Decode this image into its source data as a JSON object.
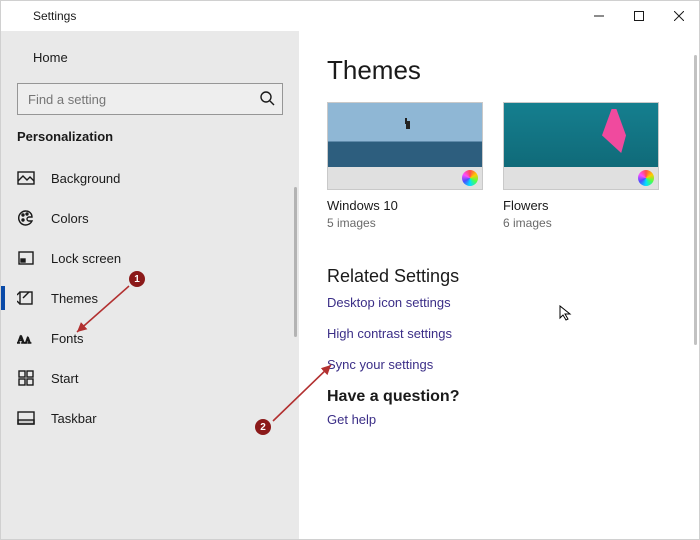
{
  "titlebar": {
    "title": "Settings"
  },
  "sidebar": {
    "home_label": "Home",
    "search_placeholder": "Find a setting",
    "section_label": "Personalization",
    "items": [
      {
        "label": "Background"
      },
      {
        "label": "Colors"
      },
      {
        "label": "Lock screen"
      },
      {
        "label": "Themes"
      },
      {
        "label": "Fonts"
      },
      {
        "label": "Start"
      },
      {
        "label": "Taskbar"
      }
    ]
  },
  "main": {
    "heading": "Themes",
    "themes": [
      {
        "name": "Windows 10",
        "sub": "5 images"
      },
      {
        "name": "Flowers",
        "sub": "6 images"
      }
    ],
    "related_heading": "Related Settings",
    "related_links": [
      "Desktop icon settings",
      "High contrast settings",
      "Sync your settings"
    ],
    "question_heading": "Have a question?",
    "help_link": "Get help"
  },
  "annotations": {
    "badge1": "1",
    "badge2": "2"
  }
}
